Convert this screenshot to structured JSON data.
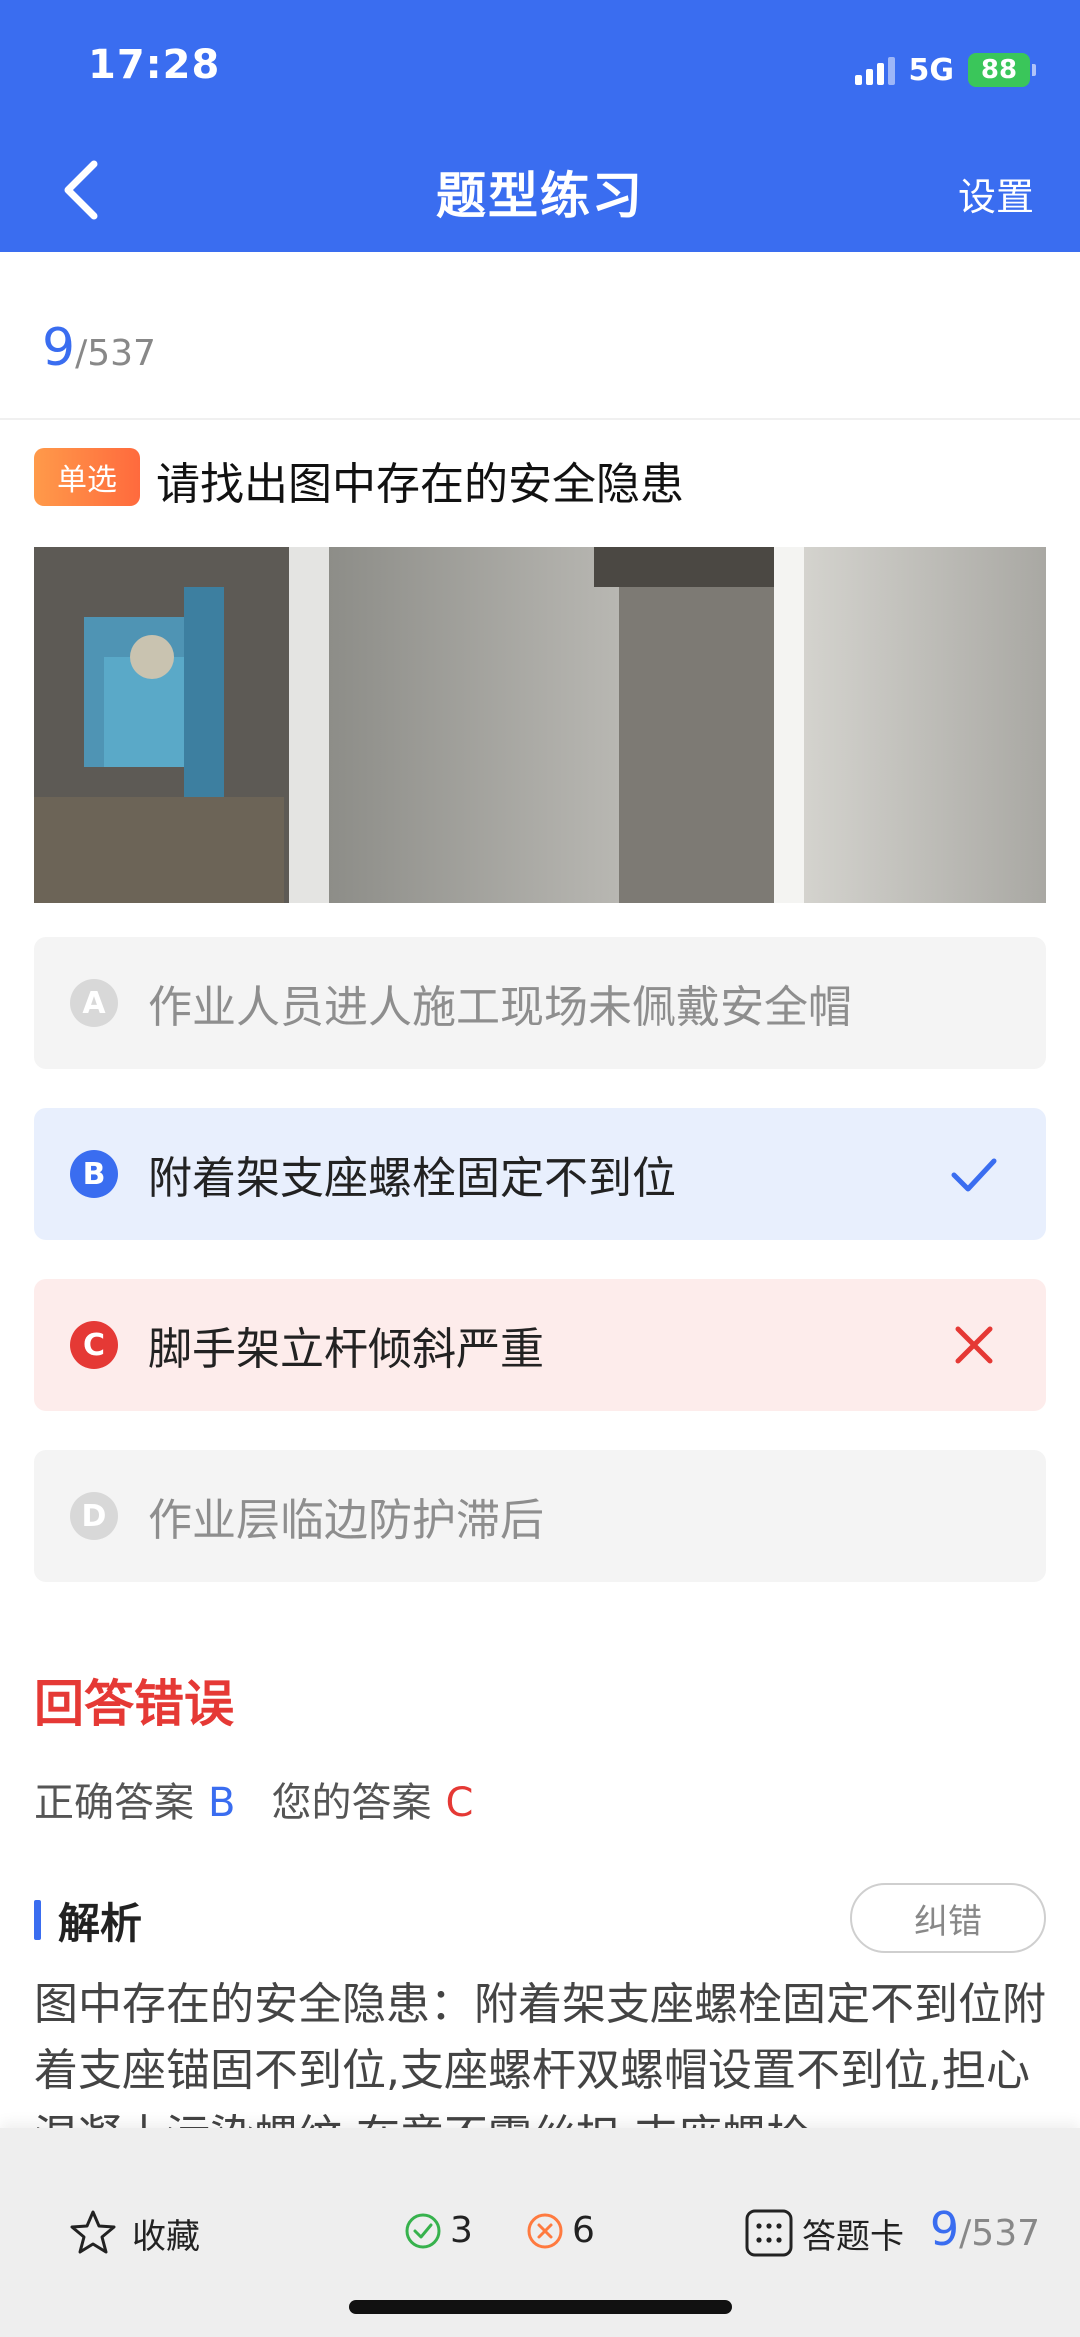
{
  "status_bar": {
    "time": "17:28",
    "network": "5G",
    "battery": "88"
  },
  "header": {
    "title": "题型练习",
    "settings_label": "设置"
  },
  "progress": {
    "current": "9",
    "total": "/537"
  },
  "question": {
    "type_tag": "单选",
    "text": "请找出图中存在的安全隐患",
    "options": [
      {
        "letter": "A",
        "text": "作业人员进人施工现场未佩戴安全帽",
        "state": "neutral"
      },
      {
        "letter": "B",
        "text": "附着架支座螺栓固定不到位",
        "state": "correct"
      },
      {
        "letter": "C",
        "text": "脚手架立杆倾斜严重",
        "state": "wrong"
      },
      {
        "letter": "D",
        "text": "作业层临边防护滞后",
        "state": "neutral"
      }
    ]
  },
  "result": {
    "title": "回答错误",
    "correct_label": "正确答案",
    "correct_value": "B",
    "your_label": "您的答案",
    "your_value": "C"
  },
  "analysis": {
    "title": "解析",
    "report_label": "纠错",
    "text": "图中存在的安全隐患：附着架支座螺栓固定不到位附着支座锚固不到位,支座螺杆双螺帽设置不到位,担心混凝土污染螺纹,在意不露丝扣,支座螺栓"
  },
  "bottom_bar": {
    "favorite_label": "收藏",
    "correct_count": "3",
    "wrong_count": "6",
    "answer_card_label": "答题卡",
    "progress_current": "9",
    "progress_total": "/537"
  },
  "colors": {
    "brand": "#3a6df0",
    "error": "#e53935",
    "correct_bg": "#e8effd",
    "wrong_bg": "#fdeceb",
    "tag_orange": "#ff7a3f",
    "ok_green": "#37b24d"
  },
  "icons": [
    "back-arrow-icon",
    "check-icon",
    "cross-icon",
    "star-icon",
    "check-circle-icon",
    "cross-circle-icon",
    "grid-icon"
  ]
}
